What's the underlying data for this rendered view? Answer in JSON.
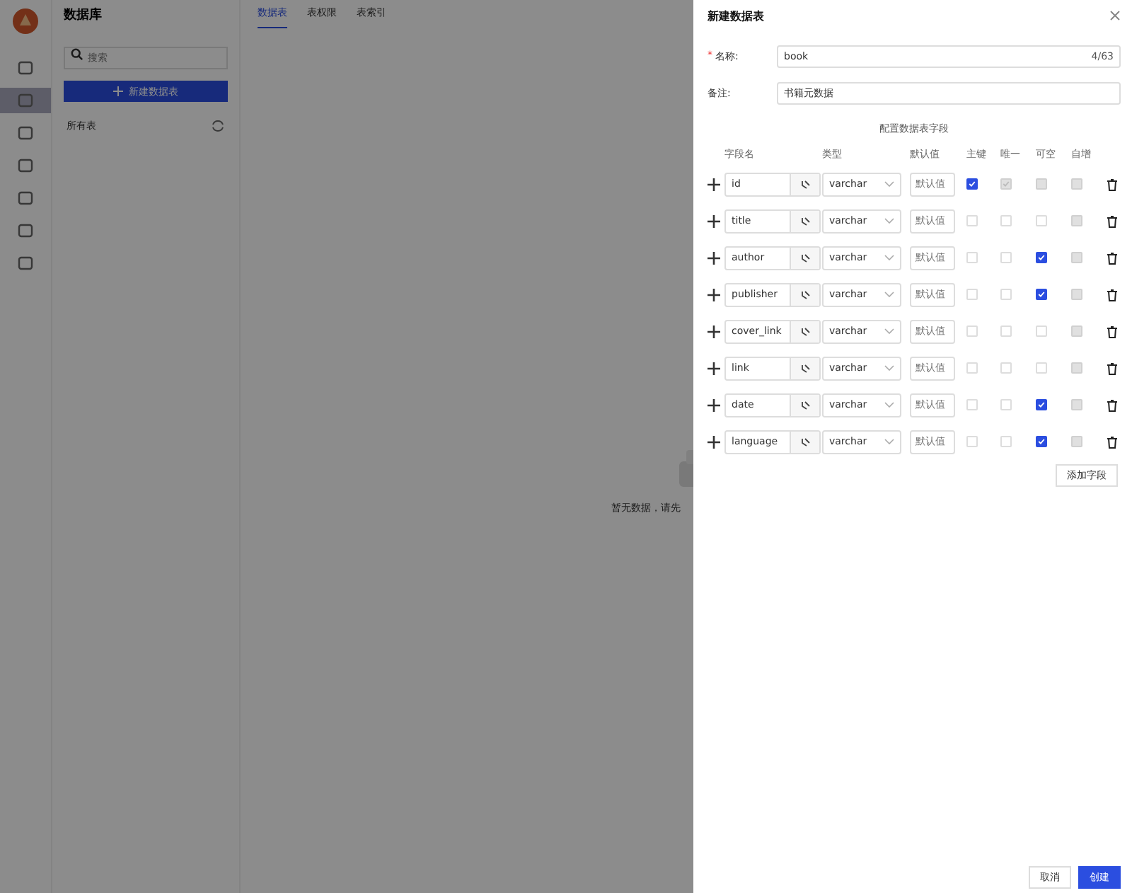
{
  "sidebar": {
    "nav": [
      {
        "selected": false
      },
      {
        "selected": true
      },
      {
        "selected": false
      },
      {
        "selected": false
      },
      {
        "selected": false
      },
      {
        "selected": false
      },
      {
        "selected": false
      }
    ]
  },
  "panel": {
    "title": "数据库",
    "search": {
      "placeholder": "搜索"
    },
    "new_button": "新建数据表",
    "list_title": "所有表"
  },
  "tabs": [
    {
      "label": "数据表",
      "selected": true
    },
    {
      "label": "表权限",
      "selected": false
    },
    {
      "label": "表索引",
      "selected": false
    }
  ],
  "empty": {
    "text": "暂无数据，请先"
  },
  "drawer": {
    "title": "新建数据表",
    "name": {
      "required_mark": "*",
      "label": "名称:",
      "value": "book",
      "count": "4/63"
    },
    "remark": {
      "label": "备注:",
      "value": "书籍元数据"
    },
    "section_title": "配置数据表字段",
    "columns": [
      "字段名",
      "类型",
      "默认值",
      "主键",
      "唯一",
      "可空",
      "自增"
    ],
    "fields": [
      {
        "name": "id",
        "type": "varchar",
        "default_placeholder": "默认值",
        "flags": [
          {
            "checked": true,
            "disabled": false
          },
          {
            "checked": true,
            "disabled": true
          },
          {
            "checked": false,
            "disabled": true
          },
          {
            "checked": false,
            "disabled": true
          }
        ]
      },
      {
        "name": "title",
        "type": "varchar",
        "default_placeholder": "默认值",
        "flags": [
          {
            "checked": false,
            "disabled": false
          },
          {
            "checked": false,
            "disabled": false
          },
          {
            "checked": false,
            "disabled": false
          },
          {
            "checked": false,
            "disabled": true
          }
        ]
      },
      {
        "name": "author",
        "type": "varchar",
        "default_placeholder": "默认值",
        "flags": [
          {
            "checked": false,
            "disabled": false
          },
          {
            "checked": false,
            "disabled": false
          },
          {
            "checked": true,
            "disabled": false
          },
          {
            "checked": false,
            "disabled": true
          }
        ]
      },
      {
        "name": "publisher",
        "type": "varchar",
        "default_placeholder": "默认值",
        "flags": [
          {
            "checked": false,
            "disabled": false
          },
          {
            "checked": false,
            "disabled": false
          },
          {
            "checked": true,
            "disabled": false
          },
          {
            "checked": false,
            "disabled": true
          }
        ]
      },
      {
        "name": "cover_link",
        "type": "varchar",
        "default_placeholder": "默认值",
        "flags": [
          {
            "checked": false,
            "disabled": false
          },
          {
            "checked": false,
            "disabled": false
          },
          {
            "checked": false,
            "disabled": false
          },
          {
            "checked": false,
            "disabled": true
          }
        ]
      },
      {
        "name": "link",
        "type": "varchar",
        "default_placeholder": "默认值",
        "flags": [
          {
            "checked": false,
            "disabled": false
          },
          {
            "checked": false,
            "disabled": false
          },
          {
            "checked": false,
            "disabled": false
          },
          {
            "checked": false,
            "disabled": true
          }
        ]
      },
      {
        "name": "date",
        "type": "varchar",
        "default_placeholder": "默认值",
        "flags": [
          {
            "checked": false,
            "disabled": false
          },
          {
            "checked": false,
            "disabled": false
          },
          {
            "checked": true,
            "disabled": false
          },
          {
            "checked": false,
            "disabled": true
          }
        ]
      },
      {
        "name": "language",
        "type": "varchar",
        "default_placeholder": "默认值",
        "flags": [
          {
            "checked": false,
            "disabled": false
          },
          {
            "checked": false,
            "disabled": false
          },
          {
            "checked": true,
            "disabled": false
          },
          {
            "checked": false,
            "disabled": true
          }
        ]
      }
    ],
    "add_button": "添加字段",
    "cancel_button": "取消",
    "create_button": "创建"
  }
}
